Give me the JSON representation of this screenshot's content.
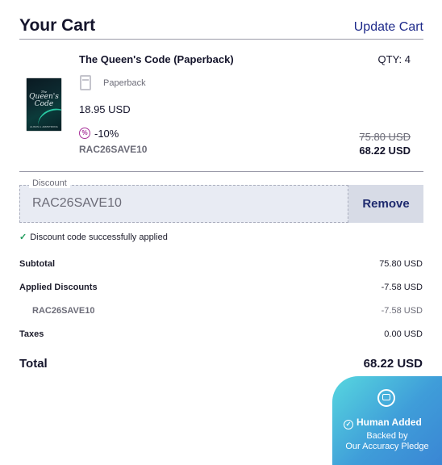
{
  "header": {
    "title": "Your Cart",
    "update_label": "Update Cart"
  },
  "item": {
    "name": "The Queen's Code (Paperback)",
    "qty": "QTY: 4",
    "format": "Paperback",
    "unit_price": "18.95 USD",
    "discount_pct": "-10%",
    "discount_code": "RAC26SAVE10",
    "original_total": "75.80 USD",
    "discounted_total": "68.22 USD",
    "cover": {
      "title_line1": "The",
      "title_line2": "Queen's",
      "title_line3": "Code",
      "author": "ALISON A. ARMSTRONG"
    }
  },
  "discount": {
    "label": "Discount",
    "value": "RAC26SAVE10",
    "remove_label": "Remove",
    "success": "Discount code successfully applied"
  },
  "summary": {
    "subtotal_label": "Subtotal",
    "subtotal": "75.80 USD",
    "applied_label": "Applied Discounts",
    "applied": "-7.58 USD",
    "code_label": "RAC26SAVE10",
    "code_amount": "-7.58 USD",
    "taxes_label": "Taxes",
    "taxes": "0.00 USD",
    "total_label": "Total",
    "total": "68.22 USD"
  },
  "badge": {
    "headline": "Human Added",
    "line1": "Backed by",
    "line2": "Our Accuracy Pledge"
  },
  "icons": {
    "format": "book-icon",
    "percent": "percent-icon",
    "check": "check-icon",
    "badge": "house-icon"
  },
  "colors": {
    "accent": "#1e2a8a",
    "success": "#1e9a5a",
    "badge": "#3f9dd9"
  }
}
